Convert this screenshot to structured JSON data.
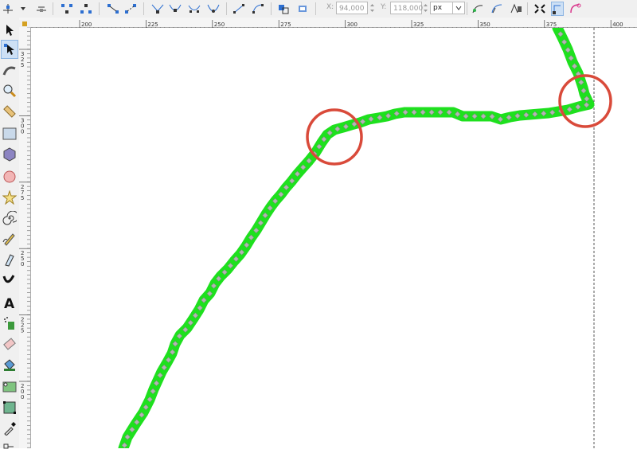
{
  "toolbar": {
    "x_label": "X:",
    "x_value": "94,000",
    "y_label": "Y:",
    "y_value": "118,000",
    "unit": "px",
    "tools_icons": [
      "insert-node-icon",
      "dropdown-icon",
      "delete-node-icon",
      "join-nodes-icon",
      "break-path-icon",
      "join-segment-icon",
      "delete-segment-icon",
      "cusp-node-icon",
      "smooth-node-icon",
      "symmetric-node-icon",
      "auto-smooth-node-icon",
      "line-segment-icon",
      "curve-segment-icon",
      "object-to-path-icon",
      "stroke-to-path-icon",
      "path-effect-icon",
      "clippath-icon",
      "mask-icon",
      "transform-handles-icon",
      "show-handles-icon",
      "show-outline-icon"
    ]
  },
  "sidebar": {
    "tools": [
      "selector-tool-icon",
      "node-tool-icon",
      "tweak-tool-icon",
      "zoom-tool-icon",
      "measure-tool-icon",
      "rect-tool-icon",
      "3dbox-tool-icon",
      "circle-tool-icon",
      "star-tool-icon",
      "spiral-tool-icon",
      "pencil-tool-icon",
      "pen-tool-icon",
      "calligraphy-tool-icon",
      "text-tool-icon",
      "spray-tool-icon",
      "eraser-tool-icon",
      "bucket-tool-icon",
      "gradient-tool-icon",
      "mesh-tool-icon",
      "dropper-tool-icon",
      "connector-tool-icon"
    ],
    "active_tool": "node-tool-icon"
  },
  "rulers": {
    "horizontal_labels": [
      "200",
      "225",
      "250",
      "275",
      "300",
      "325",
      "350",
      "375",
      "400"
    ],
    "vertical_labels": [
      "325",
      "300",
      "275",
      "250",
      "225",
      "200"
    ]
  },
  "colors": {
    "stroke": "#1ee01e",
    "node": "#b4b4b4",
    "annotation": "#d94a3a",
    "guide": "#555555"
  }
}
